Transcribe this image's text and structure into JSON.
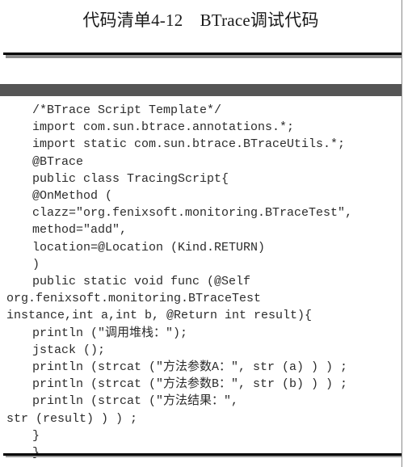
{
  "caption": {
    "text": "代码清单4-12　BTrace调试代码",
    "listing_number": "4-12",
    "listing_label": "代码清单",
    "listing_title": "BTrace调试代码"
  },
  "rules": {
    "top_rule_color": "#000000",
    "top_rule_shadow_color": "#8b8b8b",
    "band_color": "#555555",
    "bottom_rule_color": "#000000",
    "bottom_rule_shadow_color": "#9a9a9a",
    "page_edge_color": "#8a8a8a"
  },
  "code": {
    "language": "java",
    "lines": [
      {
        "text": "/*BTrace Script Template*/",
        "indent": true
      },
      {
        "text": "import com.sun.btrace.annotations.*;",
        "indent": true
      },
      {
        "text": "import static com.sun.btrace.BTraceUtils.*;",
        "indent": true
      },
      {
        "text": "@BTrace",
        "indent": true
      },
      {
        "text": "public class TracingScript{",
        "indent": true
      },
      {
        "text": "@OnMethod (",
        "indent": true
      },
      {
        "text": "clazz=\"org.fenixsoft.monitoring.BTraceTest\",",
        "indent": true
      },
      {
        "text": "method=\"add\",",
        "indent": true
      },
      {
        "text": "location=@Location (Kind.RETURN)",
        "indent": true
      },
      {
        "text": ")",
        "indent": true
      },
      {
        "text": "public static void func (@Self",
        "indent": true
      },
      {
        "text": "org.fenixsoft.monitoring.BTraceTest",
        "indent": false
      },
      {
        "text": "instance,int a,int b, @Return int result){",
        "indent": false
      },
      {
        "text": "println (\"调用堆栈：\");",
        "indent": true
      },
      {
        "text": "jstack ();",
        "indent": true
      },
      {
        "text": "println (strcat (\"方法参数A：\", str (a) ) ) ;",
        "indent": true
      },
      {
        "text": "println (strcat (\"方法参数B：\", str (b) ) ) ;",
        "indent": true
      },
      {
        "text": "println (strcat (\"方法结果：\",",
        "indent": true
      },
      {
        "text": "str (result) ) ) ;",
        "indent": false
      },
      {
        "text": "}",
        "indent": true
      },
      {
        "text": "}",
        "indent": true
      }
    ]
  }
}
